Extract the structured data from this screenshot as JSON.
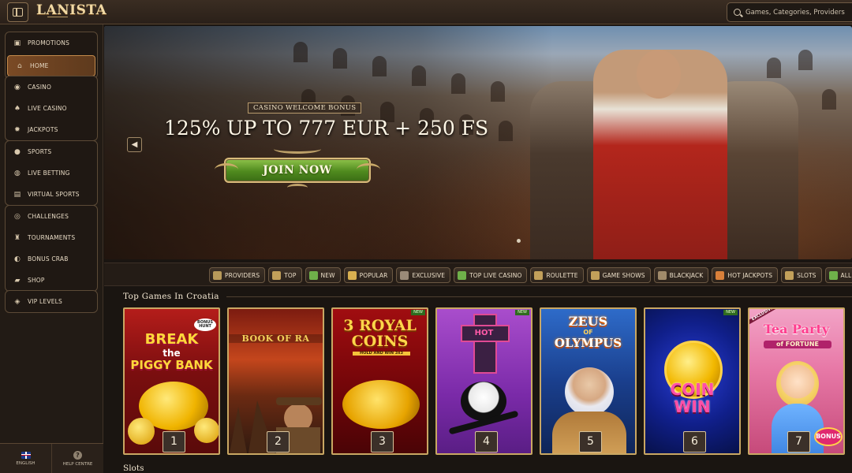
{
  "header": {
    "logo": "LANISTA",
    "search_placeholder": "Games, Categories, Providers"
  },
  "sidebar": {
    "groups": [
      [
        {
          "label": "Promotions",
          "icon": "gift-icon"
        },
        {
          "label": "Home",
          "icon": "home-icon",
          "active": true
        }
      ],
      [
        {
          "label": "Casino",
          "icon": "casino-chip-icon"
        },
        {
          "label": "Live Casino",
          "icon": "live-casino-icon"
        },
        {
          "label": "Jackpots",
          "icon": "jackpot-icon"
        }
      ],
      [
        {
          "label": "Sports",
          "icon": "sports-ball-icon"
        },
        {
          "label": "Live Betting",
          "icon": "live-betting-icon"
        },
        {
          "label": "Virtual Sports",
          "icon": "virtual-sports-icon"
        }
      ],
      [
        {
          "label": "Challenges",
          "icon": "challenges-icon"
        },
        {
          "label": "Tournaments",
          "icon": "trophy-icon"
        },
        {
          "label": "Bonus Crab",
          "icon": "crab-icon"
        },
        {
          "label": "Shop",
          "icon": "shop-bag-icon"
        }
      ],
      [
        {
          "label": "VIP Levels",
          "icon": "vip-diamond-icon"
        }
      ]
    ],
    "bottom": {
      "language": "ENGLISH",
      "help": "HELP CENTRE"
    }
  },
  "hero": {
    "tag": "CASINO WELCOME BONUS",
    "offer": "125% UP TO 777 EUR + 250 FS",
    "cta": "JOIN NOW"
  },
  "categories": [
    "PROVIDERS",
    "TOP",
    "NEW",
    "POPULAR",
    "EXCLUSIVE",
    "TOP LIVE CASINO",
    "ROULETTE",
    "GAME SHOWS",
    "BLACKJACK",
    "HOT JACKPOTS",
    "SLOTS",
    "ALL GA"
  ],
  "sections": {
    "top_games_title": "Top Games In Croatia",
    "slots_title": "Slots"
  },
  "games": [
    {
      "rank": "1",
      "title_line1": "BREAK",
      "title_line2": "the",
      "title_line3": "PIGGY BANK",
      "badge": "BONUS HUNT",
      "new": false
    },
    {
      "rank": "2",
      "title_line1": "BOOK OF RA",
      "new": false
    },
    {
      "rank": "3",
      "title_line1": "3 ROYAL",
      "title_line2": "COINS",
      "subtitle": "HOLD AND WIN 3x3",
      "new": true
    },
    {
      "rank": "4",
      "title_line1": "HOT",
      "new": true
    },
    {
      "rank": "5",
      "title_line1": "ZEUS",
      "title_line2": "OF",
      "title_line3": "OLYMPUS",
      "new": false
    },
    {
      "rank": "6",
      "title_line1": "COIN",
      "title_line2": "WIN",
      "new": true
    },
    {
      "rank": "7",
      "title_line1": "Tea Party",
      "title_line2": "of FORTUNE",
      "badge": "BONUS",
      "exclusive": "EXCLUSIVE",
      "new": false
    }
  ],
  "new_label": "NEW",
  "colors": {
    "accent_gold": "#c9a763",
    "join_green": "#5a9a24",
    "active_nav": "#7a4a25"
  }
}
